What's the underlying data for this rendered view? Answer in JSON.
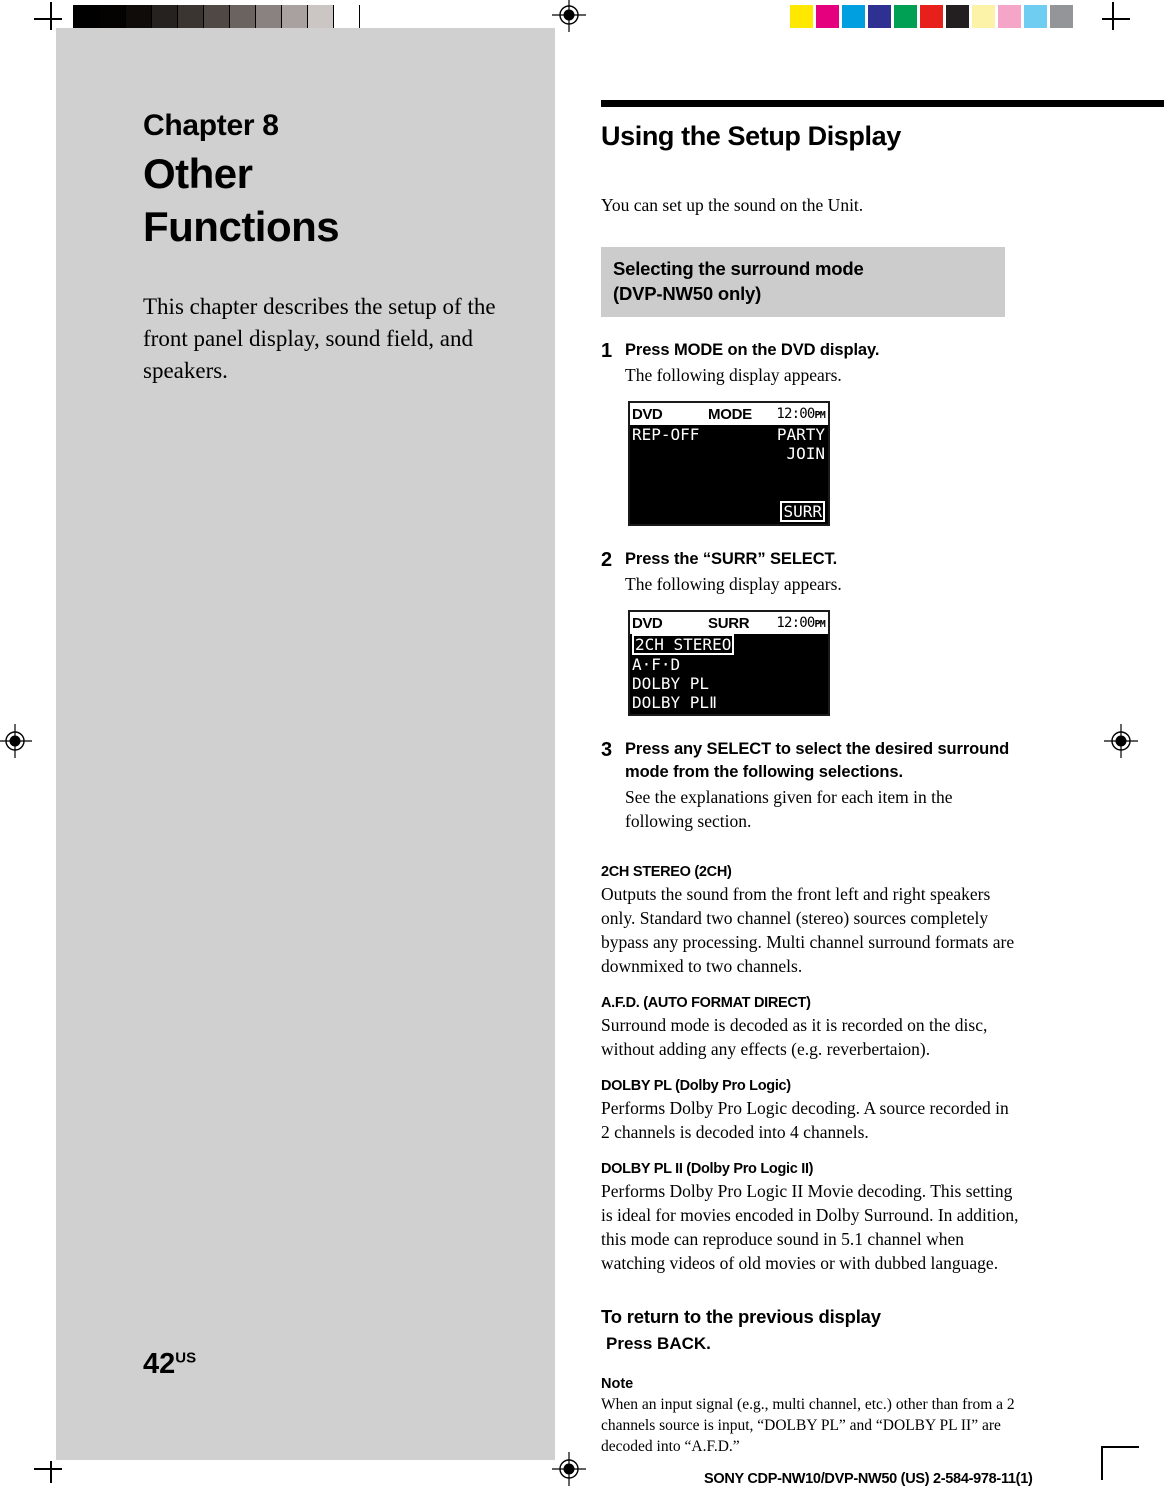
{
  "print_marks": {
    "grayscale_patches": [
      "#000000",
      "#050302",
      "#100c09",
      "#262220",
      "#3b3532",
      "#4f4845",
      "#6b6360",
      "#8a8280",
      "#a9a19f",
      "#cbc6c3",
      "#ffffff"
    ],
    "color_patches": [
      "#ffe800",
      "#e5007e",
      "#00a0e0",
      "#2e3192",
      "#00a054",
      "#e8201c",
      "#231f20",
      "#fdf3a8",
      "#f5a6c8",
      "#6fcdf2",
      "#939598"
    ]
  },
  "left_panel": {
    "chapter_label": "Chapter 8",
    "chapter_title_line1": "Other",
    "chapter_title_line2": "Functions",
    "chapter_intro": "This chapter describes the setup of the front panel display, sound field, and speakers.",
    "page_number": "42",
    "page_number_suffix": "US"
  },
  "right_panel": {
    "section_title": "Using the Setup Display",
    "lead_text": "You can set up the sound on the Unit.",
    "subhead_line1": "Selecting the surround mode",
    "subhead_line2": "(DVP-NW50 only)",
    "steps": [
      {
        "num": "1",
        "bold": "Press MODE on the DVD display.",
        "normal": "The following display appears."
      },
      {
        "num": "2",
        "bold": "Press the “SURR” SELECT.",
        "normal": "The following display appears."
      },
      {
        "num": "3",
        "bold": "Press any SELECT to select the desired surround mode from the following selections.",
        "normal": "See the explanations given for each item in the following section."
      }
    ],
    "lcd_1": {
      "header_left": "DVD",
      "header_mid": "MODE",
      "header_time": "12:00",
      "header_ampm": "PM",
      "line1_left": "REP-OFF",
      "line1_right": "PARTY",
      "line2_right": "JOIN",
      "boxed_bottom_right": "SURR"
    },
    "lcd_2": {
      "header_left": "DVD",
      "header_mid": "SURR",
      "header_time": "12:00",
      "header_ampm": "PM",
      "item_selected": "2CH STEREO",
      "items": [
        "A·F·D",
        "DOLBY PL",
        "DOLBY PLⅡ"
      ]
    },
    "definitions": [
      {
        "term": "2CH STEREO (2CH)",
        "desc": "Outputs the sound from the front left and right speakers only. Standard two channel (stereo) sources completely bypass any processing. Multi channel surround formats are downmixed to two channels."
      },
      {
        "term": "A.F.D. (AUTO FORMAT DIRECT)",
        "desc": "Surround mode is decoded as it is recorded on the disc, without adding any effects (e.g. reverbertaion)."
      },
      {
        "term": "DOLBY PL (Dolby Pro Logic)",
        "desc": "Performs Dolby Pro Logic decoding. A source recorded in 2 channels is decoded into 4 channels."
      },
      {
        "term": "DOLBY PL II (Dolby Pro Logic II)",
        "desc": "Performs Dolby Pro Logic II Movie decoding. This setting is ideal for movies encoded in Dolby Surround. In addition, this mode can reproduce sound in 5.1 channel when watching videos of old movies or with dubbed language."
      }
    ],
    "return_heading": "To return to the previous display",
    "return_body": "Press BACK.",
    "note_heading": "Note",
    "note_body": "When an input signal (e.g., multi channel, etc.) other than from a 2 channels source is input, “DOLBY PL” and “DOLBY PL II” are decoded into “A.F.D.”"
  },
  "footer": {
    "text": "SONY CDP-NW10/DVP-NW50 (US) 2-584-978-11(1)"
  }
}
